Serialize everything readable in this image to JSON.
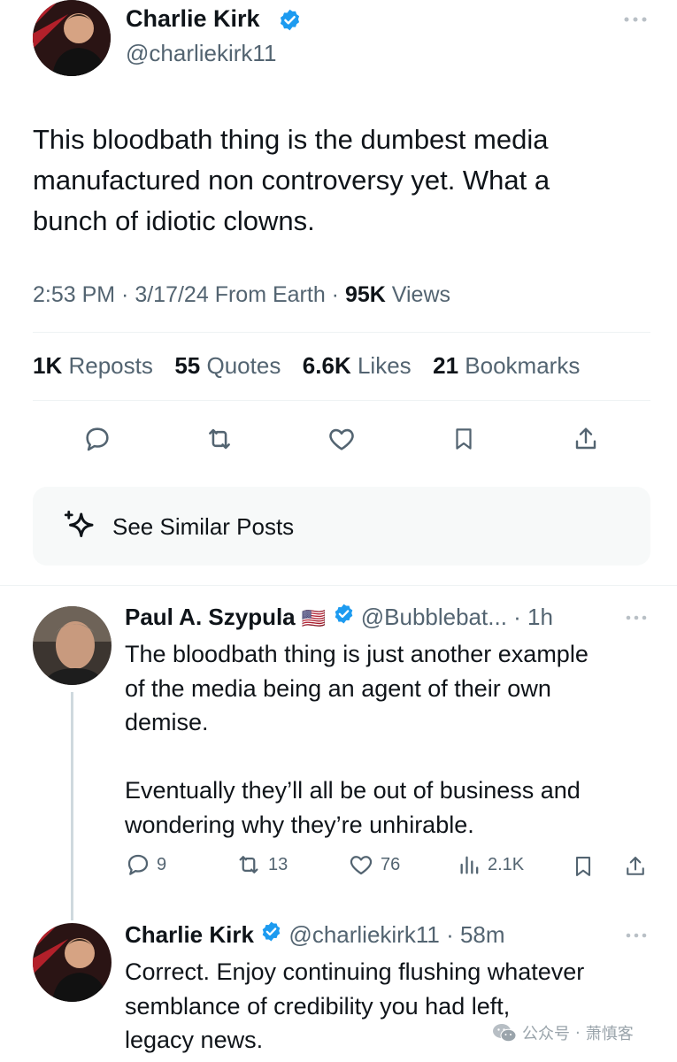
{
  "main_tweet": {
    "author_name": "Charlie Kirk",
    "handle": "@charliekirk11",
    "text_line1": "This bloodbath thing is the dumbest media",
    "text_line2": "manufactured non controversy yet. What a",
    "text_line3": "bunch of idiotic clowns.",
    "time": "2:53 PM",
    "date": "3/17/24",
    "source": "From Earth",
    "views_count": "95K",
    "views_label": "Views",
    "stats": {
      "reposts_count": "1K",
      "reposts_label": "Reposts",
      "quotes_count": "55",
      "quotes_label": "Quotes",
      "likes_count": "6.6K",
      "likes_label": "Likes",
      "bookmarks_count": "21",
      "bookmarks_label": "Bookmarks"
    }
  },
  "similar_posts_label": "See Similar Posts",
  "reply1": {
    "author_name": "Paul A. Szypula",
    "flag": "🇺🇸",
    "handle": "@Bubblebat...",
    "age": "1h",
    "text_line1": "The bloodbath thing is just another example",
    "text_line2": "of the media being an agent of their own",
    "text_line3": "demise.",
    "text_line4": "Eventually they’ll all be out of business and",
    "text_line5": "wondering why they’re unhirable.",
    "replies": "9",
    "reposts": "13",
    "likes": "76",
    "views": "2.1K"
  },
  "reply2": {
    "author_name": "Charlie Kirk",
    "handle": "@charliekirk11",
    "age": "58m",
    "text_line1": "Correct. Enjoy continuing flushing whatever",
    "text_line2": "semblance of credibility you had left,",
    "text_line3": "legacy news."
  },
  "watermark": {
    "channel": "公众号",
    "separator": "·",
    "author": "萧慎客"
  },
  "colors": {
    "text": "#0f1419",
    "muted": "#536471",
    "verified": "#1d9bf0",
    "divider": "#eff3f4",
    "card_bg": "#f7f9f9"
  }
}
